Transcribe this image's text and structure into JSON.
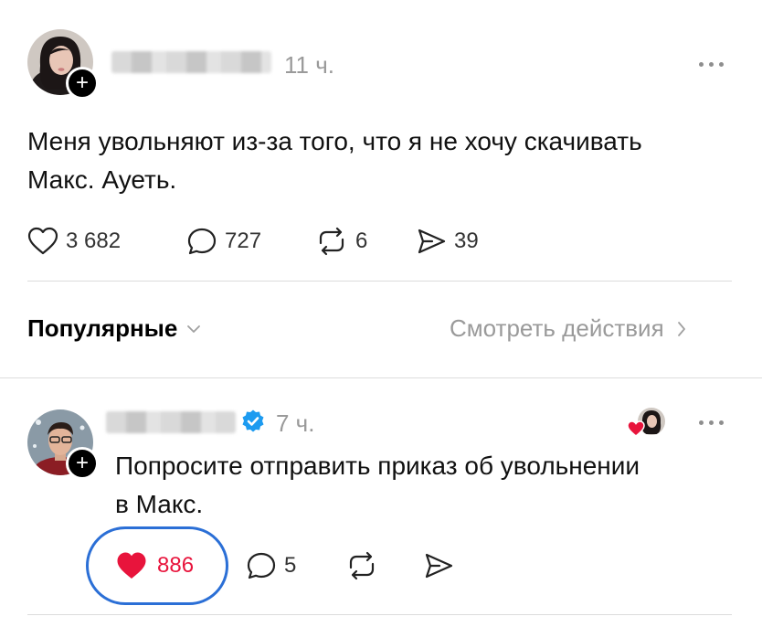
{
  "post": {
    "time": "11 ч.",
    "text_line1": "Меня увольняют из-за того, что я не хочу скачивать",
    "text_line2": "Макс. Ауеть.",
    "likes": "3 682",
    "comments": "727",
    "reposts": "6",
    "shares": "39"
  },
  "filter": {
    "label": "Популярные",
    "view_activity": "Смотреть действия"
  },
  "reply": {
    "time": "7 ч.",
    "text_line1": "Попросите отправить приказ об увольнении",
    "text_line2": "в Макс.",
    "likes": "886",
    "comments": "5"
  },
  "colors": {
    "like_active": "#e8143c",
    "verified": "#1d9bf0",
    "highlight_ring": "#2b6fd6",
    "muted": "#9a9a9a"
  },
  "icons": {
    "like": "heart-icon",
    "comment": "comment-icon",
    "repost": "repost-icon",
    "share": "share-icon",
    "more": "more-icon",
    "follow": "plus-icon",
    "verified": "verified-badge-icon"
  }
}
